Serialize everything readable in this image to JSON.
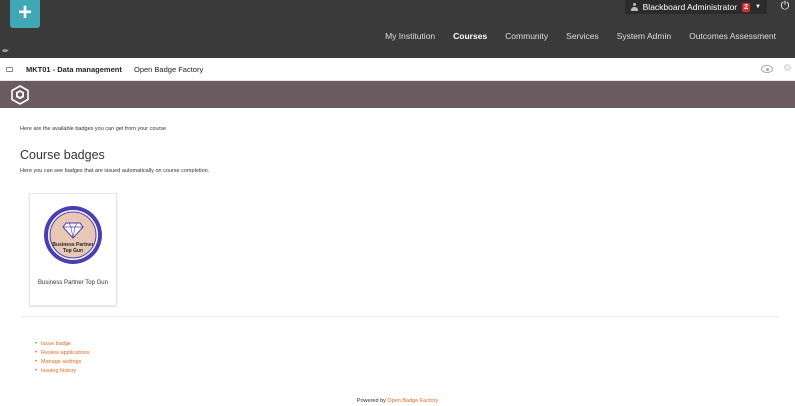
{
  "header": {
    "user_name": "Blackboard Administrator",
    "notification_count": "2",
    "nav": [
      {
        "label": "My Institution"
      },
      {
        "label": "Courses"
      },
      {
        "label": "Community"
      },
      {
        "label": "Services"
      },
      {
        "label": "System Admin"
      },
      {
        "label": "Outcomes Assessment"
      }
    ],
    "active_nav": "Courses"
  },
  "breadcrumb": {
    "course": "MKT01 - Data management",
    "page": "Open Badge Factory"
  },
  "content": {
    "intro": "Here are the available badges you can get from your course",
    "heading": "Course badges",
    "subheading": "Here you can see badges that are issued automatically on course completion.",
    "badges": [
      {
        "name": "Business Partner Top Gun",
        "image_text_line1": "Business Partner",
        "image_text_line2": "Top Gun"
      }
    ],
    "actions": [
      {
        "label": "Issue badge"
      },
      {
        "label": "Review applications"
      },
      {
        "label": "Manage settings"
      },
      {
        "label": "Issuing history"
      }
    ]
  },
  "footer": {
    "prefix": "Powered by",
    "link": "Open Badge Factory"
  },
  "colors": {
    "topbar": "#3a3a3a",
    "accent": "#3fa7b5",
    "banner": "#6b5b60",
    "link": "#e56b1f",
    "badge_ring": "#4a3fb0"
  },
  "icons": [
    "plus-icon",
    "user-icon",
    "power-icon",
    "wrench-icon",
    "menu-icon",
    "eye-icon",
    "gear-icon",
    "obf-logo-icon"
  ]
}
